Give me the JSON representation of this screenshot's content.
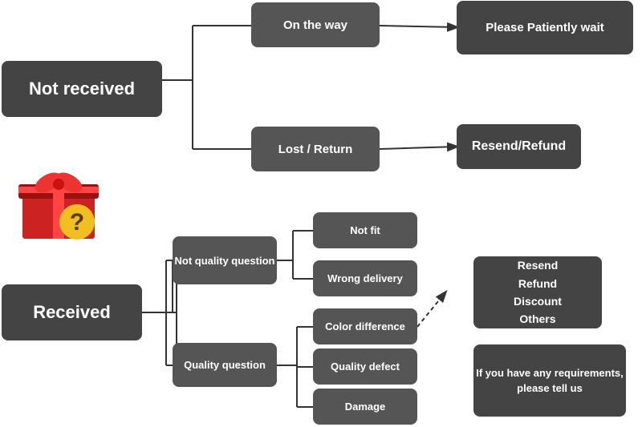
{
  "nodes": {
    "not_received": "Not received",
    "on_the_way": "On the way",
    "please_wait": "Please Patiently wait",
    "lost_return": "Lost / Return",
    "resend_refund_top": "Resend/Refund",
    "received": "Received",
    "not_quality": "Not quality question",
    "quality_question": "Quality question",
    "not_fit": "Not fit",
    "wrong_delivery": "Wrong delivery",
    "color_difference": "Color difference",
    "quality_defect": "Quality defect",
    "damage": "Damage",
    "solutions": "Resend\nRefund\nDiscount\nOthers",
    "if_you_have": "If you have any requirements, please tell us"
  },
  "colors": {
    "dark_node": "#444444",
    "medium_node": "#555555",
    "line_color": "#333333",
    "question_mark_bg": "#f0c020",
    "question_mark_color": "#5a3a00",
    "gift_red": "#cc2222",
    "gift_dark_red": "#991111",
    "gift_ribbon": "#cc2222",
    "gift_bow": "#ee3333"
  }
}
